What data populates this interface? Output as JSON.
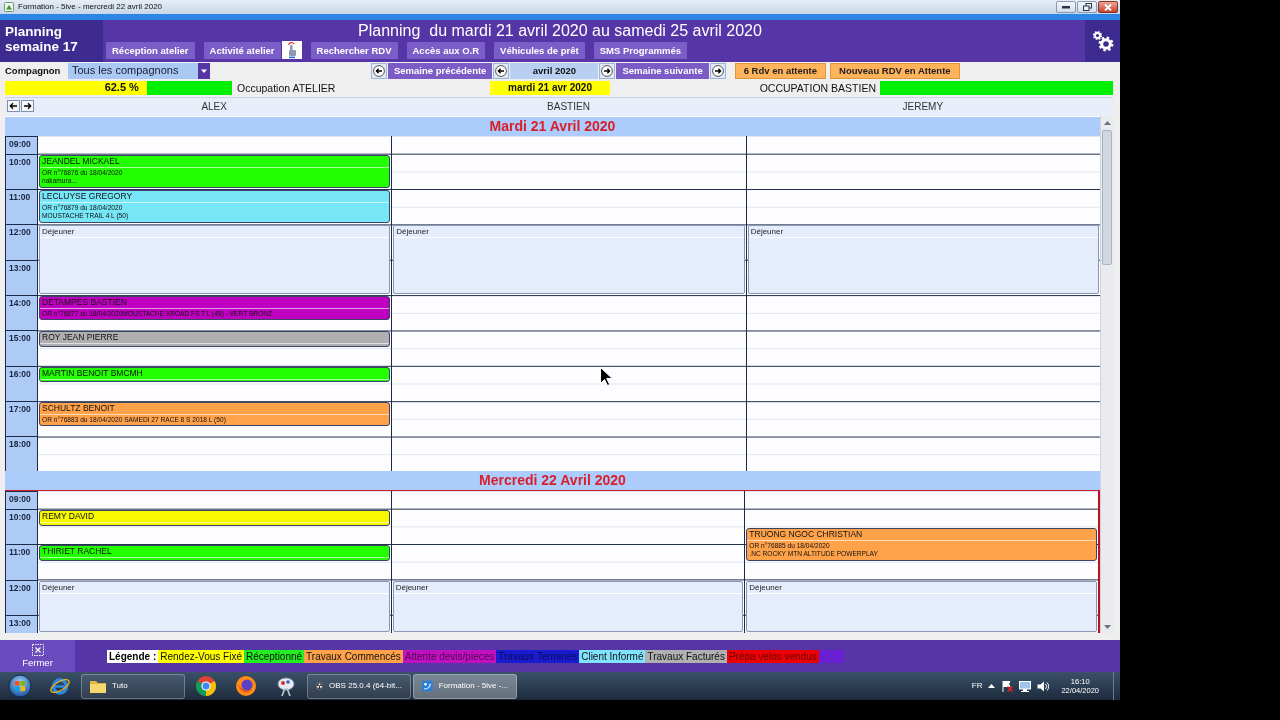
{
  "window": {
    "title": "Formation - 5ive - mercredi 22 avril 2020"
  },
  "header": {
    "week_label": "Planning semaine 17",
    "title": "Planning  du mardi 21 avril 2020 au samedi 25 avril 2020",
    "buttons": [
      {
        "label": "Réception atelier",
        "kind": "plain"
      },
      {
        "label": "Activité atelier",
        "kind": "with_icon"
      },
      {
        "label": "Rechercher RDV",
        "kind": "plain"
      },
      {
        "label": "Accès aux O.R",
        "kind": "plain"
      },
      {
        "label": "Véhicules de prêt",
        "kind": "plain"
      },
      {
        "label": "SMS Programmés",
        "kind": "plain"
      }
    ]
  },
  "toolbar": {
    "companion_label": "Compagnon",
    "companion_select": {
      "value": "Tous les compagnons"
    },
    "previous_week": "Semaine précédente",
    "month": "avril 2020",
    "next_week": "Semaine suivante",
    "pending_button": "6 Rdv en attente",
    "new_pending_button": "Nouveau RDV en Attente"
  },
  "occupation": {
    "workshop": {
      "level": 0.625,
      "reading": "62.5 %",
      "label": "Occupation ATELIER"
    },
    "date": "mardi 21 avr 2020",
    "companion": {
      "label": "OCCUPATION BASTIEN",
      "level": 0
    }
  },
  "columns": [
    "ALEX",
    "BASTIEN",
    "JEREMY"
  ],
  "days": [
    {
      "title": "Mardi 21 Avril 2020",
      "today": false,
      "times": [
        "09:00",
        "10:00",
        "11:00",
        "12:00",
        "13:00",
        "14:00",
        "15:00",
        "16:00",
        "17:00",
        "18:00"
      ],
      "lanes": [
        {
          "slots": [
            {
              "kind": "free"
            },
            {
              "kind": "free"
            },
            {
              "kind": "appointment",
              "name": "JEANDEL MICKAEL",
              "lines": [
                "OR n°76876 du 18/04/2020",
                "nakamura..."
              ],
              "color": "#22ff00"
            },
            {
              "kind": "more"
            },
            {
              "kind": "more"
            },
            {
              "kind": "more"
            },
            {
              "kind": "appointment",
              "name": "LECLUYSE GREGORY",
              "lines": [
                "OR n°76879 du 18/04/2020",
                "MOUSTACHE TRAIL 4 L (50)"
              ],
              "color": "#77e6f6"
            },
            {
              "kind": "more"
            },
            {
              "kind": "more"
            },
            {
              "kind": "more"
            },
            {
              "kind": "break",
              "name": "Déjeuner"
            },
            {
              "kind": "more"
            },
            {
              "kind": "more"
            },
            {
              "kind": "more"
            },
            {
              "kind": "more"
            },
            {
              "kind": "more"
            },
            {
              "kind": "more"
            },
            {
              "kind": "more"
            },
            {
              "kind": "appointment",
              "name": "DETAMPES BASTIEN",
              "lines": [
                "OR n°76877 du 18/04/2020MOUSTACHE XROAD FS 7 L (49) - VERT BRONZ"
              ],
              "color": "#c000c0"
            },
            {
              "kind": "more"
            },
            {
              "kind": "more"
            },
            {
              "kind": "free"
            },
            {
              "kind": "appointment",
              "name": "ROY JEAN PIERRE",
              "color": "#b0aeb0"
            },
            {
              "kind": "more"
            },
            {
              "kind": "free"
            },
            {
              "kind": "free"
            },
            {
              "kind": "appointment",
              "name": "MARTIN BENOIT BMCMH",
              "color": "#22ff00"
            },
            {
              "kind": "more"
            },
            {
              "kind": "free"
            },
            {
              "kind": "free"
            },
            {
              "kind": "appointment",
              "name": "SCHULTZ BENOIT",
              "lines": [
                "OR n°76883 du 18/04/2020 SAMEDI 27 RACE 8 S 2018 L (50)"
              ],
              "color": "#ffa24a"
            },
            {
              "kind": "more"
            },
            {
              "kind": "more"
            }
          ]
        },
        {
          "slots": [
            {
              "kind": "free"
            },
            {
              "kind": "free"
            },
            {
              "kind": "free"
            },
            {
              "kind": "free"
            },
            {
              "kind": "free"
            },
            {
              "kind": "free"
            },
            {
              "kind": "free"
            },
            {
              "kind": "free"
            },
            {
              "kind": "free"
            },
            {
              "kind": "free"
            },
            {
              "kind": "break",
              "name": "Déjeuner"
            },
            {
              "kind": "more"
            },
            {
              "kind": "more"
            },
            {
              "kind": "more"
            },
            {
              "kind": "more"
            },
            {
              "kind": "more"
            },
            {
              "kind": "more"
            },
            {
              "kind": "more"
            }
          ]
        },
        {
          "slots": [
            {
              "kind": "free"
            },
            {
              "kind": "free"
            },
            {
              "kind": "free"
            },
            {
              "kind": "free"
            },
            {
              "kind": "free"
            },
            {
              "kind": "free"
            },
            {
              "kind": "free"
            },
            {
              "kind": "free"
            },
            {
              "kind": "free"
            },
            {
              "kind": "free"
            },
            {
              "kind": "break",
              "name": "Déjeuner"
            },
            {
              "kind": "more"
            },
            {
              "kind": "more"
            },
            {
              "kind": "more"
            },
            {
              "kind": "more"
            },
            {
              "kind": "more"
            },
            {
              "kind": "more"
            },
            {
              "kind": "more"
            }
          ]
        }
      ]
    },
    {
      "title": "Mercredi 22 Avril 2020",
      "today": true,
      "times": [
        "09:00",
        "10:00",
        "11:00",
        "12:00",
        "13:00"
      ],
      "lanes": [
        {
          "slots": [
            {
              "kind": "free"
            },
            {
              "kind": "free"
            },
            {
              "kind": "appointment",
              "name": "REMY DAVID",
              "color": "#f8f800"
            },
            {
              "kind": "more"
            },
            {
              "kind": "free"
            },
            {
              "kind": "free"
            },
            {
              "kind": "appointment",
              "name": "THIRIET RACHEL",
              "color": "#22ff00"
            },
            {
              "kind": "more"
            },
            {
              "kind": "free"
            },
            {
              "kind": "free"
            },
            {
              "kind": "break",
              "name": "Déjeuner"
            },
            {
              "kind": "more"
            },
            {
              "kind": "more"
            },
            {
              "kind": "more"
            },
            {
              "kind": "more"
            },
            {
              "kind": "more"
            }
          ]
        },
        {
          "slots": [
            {
              "kind": "free"
            },
            {
              "kind": "free"
            },
            {
              "kind": "free"
            },
            {
              "kind": "free"
            },
            {
              "kind": "free"
            },
            {
              "kind": "free"
            },
            {
              "kind": "free"
            },
            {
              "kind": "free"
            },
            {
              "kind": "free"
            },
            {
              "kind": "free"
            },
            {
              "kind": "break",
              "name": "Déjeuner"
            },
            {
              "kind": "more"
            },
            {
              "kind": "more"
            },
            {
              "kind": "more"
            },
            {
              "kind": "more"
            },
            {
              "kind": "more"
            }
          ]
        },
        {
          "slots": [
            {
              "kind": "free"
            },
            {
              "kind": "free"
            },
            {
              "kind": "free"
            },
            {
              "kind": "free"
            },
            {
              "kind": "appointment",
              "name": "TRUONG NGOC CHRISTIAN",
              "lines": [
                "OR n°76885 du 18/04/2020",
                ".NC ROCKY MTN ALTITUDE POWERPLAY"
              ],
              "color": "#ffa24a"
            },
            {
              "kind": "more"
            },
            {
              "kind": "more"
            },
            {
              "kind": "more"
            },
            {
              "kind": "free"
            },
            {
              "kind": "free"
            },
            {
              "kind": "break",
              "name": "Déjeuner"
            },
            {
              "kind": "more"
            },
            {
              "kind": "more"
            },
            {
              "kind": "more"
            },
            {
              "kind": "more"
            },
            {
              "kind": "more"
            }
          ]
        }
      ]
    }
  ],
  "legend": {
    "title": "Légende :",
    "items": [
      {
        "label": "Rendez-Vous Fixé",
        "color": "#ffff00"
      },
      {
        "label": "Réceptionné",
        "color": "#22ee22"
      },
      {
        "label": "Travaux Commencés",
        "color": "#ffa24a"
      },
      {
        "label": "Attente devis/pieces",
        "color": "#c010c0"
      },
      {
        "label": "Travaux Terminés",
        "color": "#1a1ad0"
      },
      {
        "label": "Client Informé",
        "color": "#80e4ff"
      },
      {
        "label": "Travaux Facturés",
        "color": "#b0b0b0"
      },
      {
        "label": "Prépa velos vendus",
        "color": "#ee0000"
      },
      {
        "color": "#6a20d0"
      }
    ]
  },
  "footer": {
    "close_button": "Fermer"
  },
  "taskbar": {
    "items": [
      {
        "kind": "start"
      },
      {
        "kind": "browser"
      },
      {
        "kind": "folder",
        "label": "Tuto",
        "selected": false
      },
      {
        "kind": "wheel"
      },
      {
        "kind": "flame"
      },
      {
        "kind": "tool"
      },
      {
        "kind": "recorder",
        "label": "OBS 25.0.4 (64-bit...",
        "selected": false
      },
      {
        "kind": "app",
        "label": "Formation - 5ive -...",
        "selected": true
      }
    ],
    "language": "FR",
    "time": "16:10",
    "date": "22/04/2020"
  }
}
